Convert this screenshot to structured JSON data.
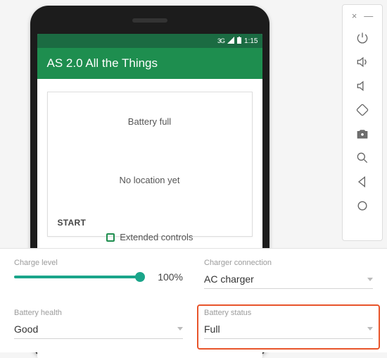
{
  "statusbar": {
    "signal_3g": "3G",
    "time": "1:15"
  },
  "app": {
    "title": "AS 2.0 All the Things",
    "battery_text": "Battery full",
    "location_text": "No location yet",
    "start_label": "START"
  },
  "extcontrols_label": "Extended controls",
  "toolbar": {
    "close": "×",
    "minimize": "—"
  },
  "panel": {
    "charge_level": {
      "label": "Charge level",
      "value": "100%"
    },
    "charger_connection": {
      "label": "Charger connection",
      "value": "AC charger"
    },
    "battery_health": {
      "label": "Battery health",
      "value": "Good"
    },
    "battery_status": {
      "label": "Battery status",
      "value": "Full"
    }
  }
}
